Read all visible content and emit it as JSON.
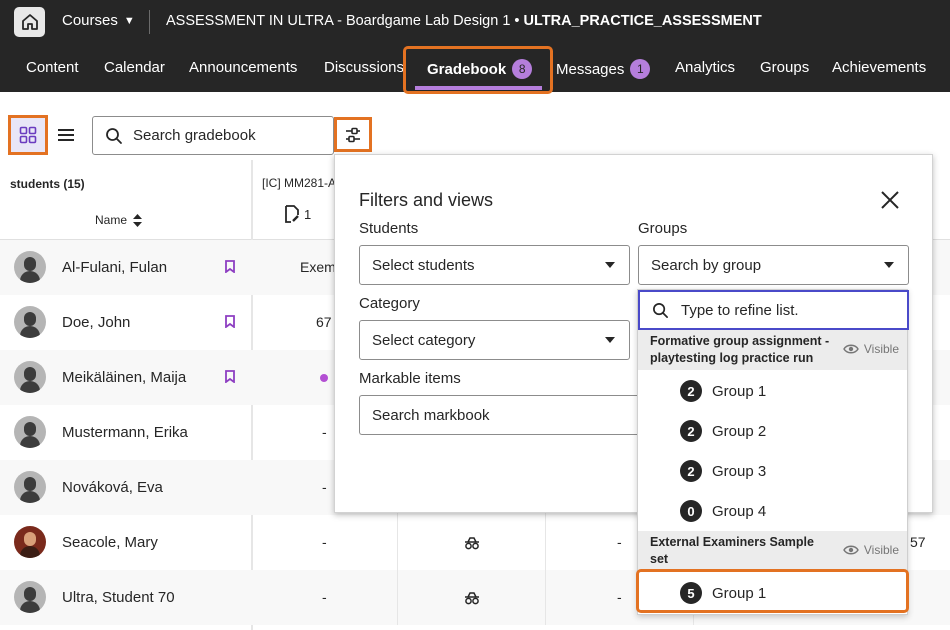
{
  "topbar": {
    "courses_label": "Courses",
    "course_title": "ASSESSMENT IN ULTRA - Boardgame Lab Design 1",
    "course_bullet": " • ",
    "course_code": "ULTRA_PRACTICE_ASSESSMENT"
  },
  "nav": {
    "content": "Content",
    "calendar": "Calendar",
    "announcements": "Announcements",
    "discussions": "Discussions",
    "gradebook": "Gradebook",
    "gradebook_badge": "8",
    "messages": "Messages",
    "messages_badge": "1",
    "analytics": "Analytics",
    "groups": "Groups",
    "achievements": "Achievements"
  },
  "toolbar": {
    "search_placeholder": "Search gradebook"
  },
  "table": {
    "students_count": "students (15)",
    "name_header": "Name",
    "column1_title": "[IC] MM281-A",
    "column1_count": "1",
    "rows": [
      {
        "name": "Al-Fulani, Fulan",
        "flag": true,
        "cell1": "Exem",
        "photo": false
      },
      {
        "name": "Doe, John",
        "flag": true,
        "cell1": "67",
        "photo": false
      },
      {
        "name": "Meikäläinen, Maija",
        "flag": true,
        "cell1": "",
        "dot": true,
        "photo": false
      },
      {
        "name": "Mustermann, Erika",
        "flag": false,
        "cell1": "-",
        "photo": false
      },
      {
        "name": "Nováková, Eva",
        "flag": false,
        "cell1": "-",
        "photo": false
      },
      {
        "name": "Seacole, Mary",
        "flag": false,
        "cell1": "-",
        "cell3": "-",
        "cell_right": "57",
        "icon": true,
        "photo": true
      },
      {
        "name": "Ultra, Student 70",
        "flag": false,
        "cell1": "-",
        "cell3": "-",
        "icon": true,
        "photo": false
      }
    ]
  },
  "filters": {
    "title": "Filters and views",
    "students_label": "Students",
    "students_value": "Select students",
    "groups_label": "Groups",
    "groups_value": "Search by group",
    "category_label": "Category",
    "category_value": "Select category",
    "markable_label": "Markable items",
    "markable_placeholder": "Search markbook"
  },
  "group_list": {
    "refine_placeholder": "Type to refine list.",
    "sets": [
      {
        "name": "Formative group assignment - playtesting log practice run",
        "visibility": "Visible",
        "groups": [
          {
            "count": "2",
            "name": "Group 1"
          },
          {
            "count": "2",
            "name": "Group 2"
          },
          {
            "count": "2",
            "name": "Group 3"
          },
          {
            "count": "0",
            "name": "Group 4"
          }
        ]
      },
      {
        "name": "External Examiners Sample set",
        "visibility": "Visible",
        "groups": [
          {
            "count": "5",
            "name": "Group 1"
          }
        ]
      }
    ]
  },
  "colors": {
    "highlight": "#e37222",
    "accent_purple": "#b57edc",
    "topbar_bg": "#262626"
  }
}
